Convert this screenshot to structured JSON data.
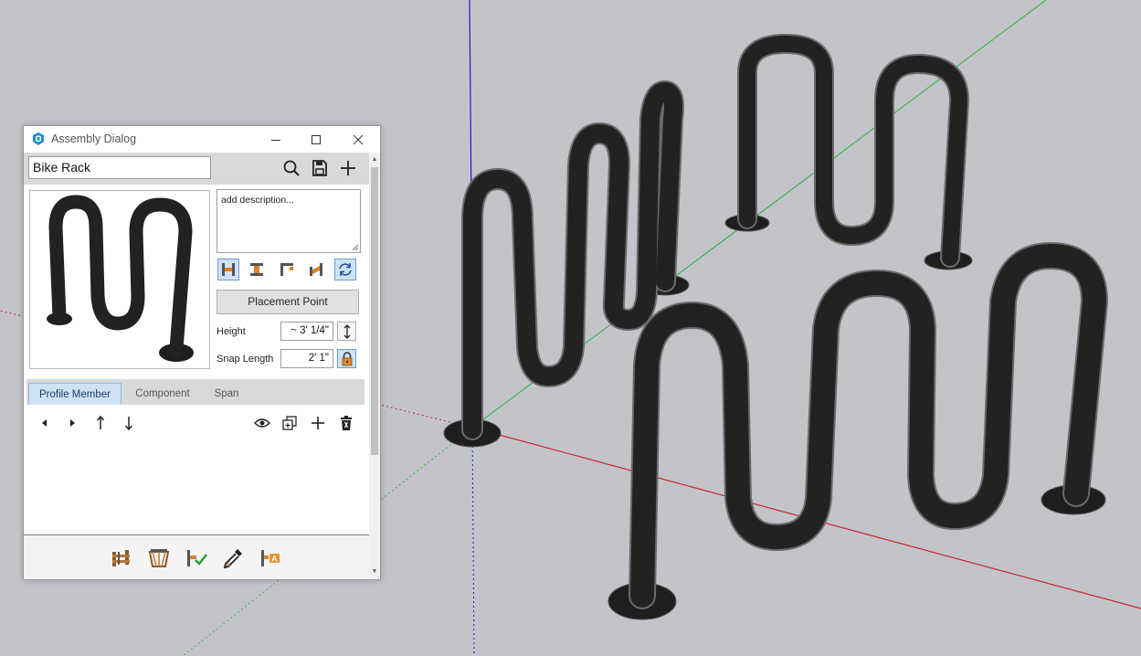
{
  "dialog": {
    "title": "Assembly Dialog",
    "assembly_name": "Bike Rack",
    "description_placeholder": "add description...",
    "placement_point_label": "Placement Point",
    "height_label": "Height",
    "height_value": "~ 3' 1/4\"",
    "snap_length_label": "Snap Length",
    "snap_length_value": "2' 1\"",
    "tabs": [
      "Profile Member",
      "Component",
      "Span"
    ],
    "active_tab": "Profile Member"
  },
  "icons": {
    "app": "sketchup-logo-icon",
    "header": [
      "search-icon",
      "save-icon",
      "add-icon"
    ],
    "mode_buttons": [
      "member-mode-icon",
      "column-mode-icon",
      "corner-mode-icon",
      "span-mode-icon",
      "rotate-icon"
    ],
    "list_tools": [
      "arrow-left-icon",
      "arrow-right-icon",
      "arrow-up-icon",
      "arrow-down-icon",
      "eye-icon",
      "duplicate-icon",
      "add-icon",
      "delete-icon"
    ],
    "footer_tools": [
      "build-icon",
      "truss-icon",
      "validate-icon",
      "eyedropper-icon",
      "label-icon"
    ]
  },
  "colors": {
    "active_blue": "#cfe2f5",
    "axis_red": "#c4272c",
    "axis_green": "#3ab44a",
    "axis_blue": "#1c1ccc",
    "rack_black": "#1e1e1e"
  }
}
